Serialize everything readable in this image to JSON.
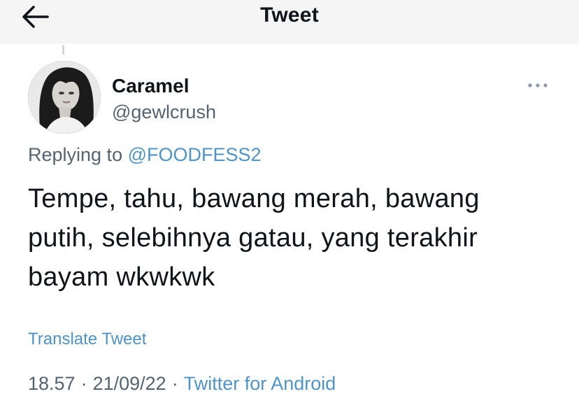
{
  "header": {
    "title": "Tweet",
    "back_icon": "arrow-left-icon"
  },
  "author": {
    "display_name": "Caramel",
    "handle": "@gewlcrush",
    "avatar_icon": "profile-photo",
    "more_icon": "more-horizontal-icon"
  },
  "reply": {
    "prefix": "Replying to ",
    "target": "@FOODFESS2"
  },
  "tweet": {
    "lines": [
      "Tempe, tahu, bawang merah, bawang",
      "putih, selebihnya gatau, yang terakhir",
      "bayam wkwkwk"
    ],
    "translate_label": "Translate Tweet",
    "time": "18.57",
    "separator": "·",
    "date": "21/09/22",
    "source": "Twitter for Android"
  },
  "colors": {
    "link": "#4e94c8",
    "secondary_text": "#536471",
    "primary_text": "#0f1419",
    "header_bg": "#f5f5f5"
  }
}
